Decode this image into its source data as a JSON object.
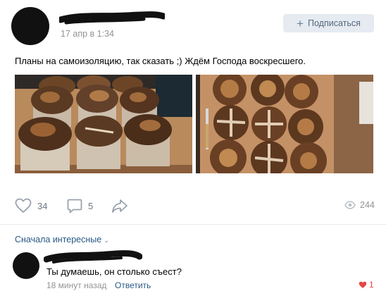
{
  "post": {
    "time": "17 апр в 1:34",
    "subscribe_label": "Подписаться",
    "text": "Планы на самоизоляцию, так сказать ;) Ждём Господа воскресшего."
  },
  "actions": {
    "likes_count": "34",
    "comments_count": "5",
    "views_count": "244"
  },
  "comments_section": {
    "sort_label": "Сначала интересные"
  },
  "comment": {
    "text": "Ты думаешь, он столько съест?",
    "time": "18 минут назад",
    "reply_label": "Ответить",
    "likes_count": "1"
  },
  "colors": {
    "accent_link": "#2a5885",
    "button_bg": "#e5ebf1",
    "muted_text": "#939393",
    "like_red": "#e64646"
  },
  "icons": [
    "heart-icon",
    "comment-icon",
    "share-icon",
    "eye-icon",
    "plus-icon",
    "chevron-down-icon"
  ]
}
